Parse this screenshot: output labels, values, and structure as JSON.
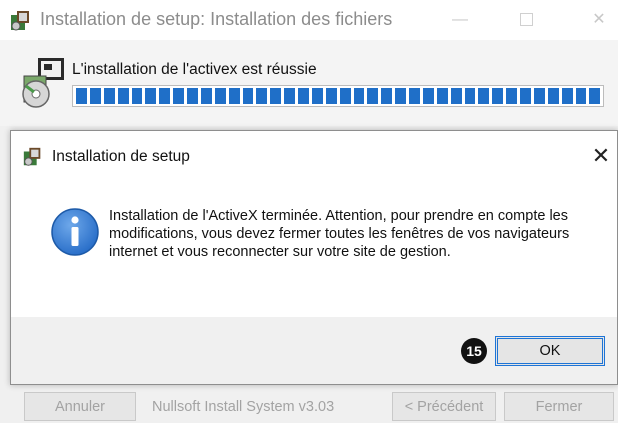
{
  "background_window": {
    "title": "Installation de setup: Installation des fichiers",
    "status_text": "L'installation de l'activex est réussie",
    "progress_percent": 100,
    "branding": "Nullsoft Install System v3.03",
    "buttons": {
      "cancel": "Annuler",
      "back": "< Précédent",
      "close": "Fermer"
    },
    "controls": {
      "minimize": "—",
      "close": "✕"
    }
  },
  "dialog": {
    "title": "Installation de setup",
    "close_glyph": "✕",
    "icon": "information-icon",
    "message": "Installation de l'ActiveX terminée. Attention, pour prendre en compte les modifications, vous devez fermer toutes les fenêtres de vos navigateurs internet et vous reconnecter sur votre site de gestion.",
    "ok_label": "OK"
  },
  "callout": {
    "number": "15"
  },
  "colors": {
    "progress_fill": "#1f6fc8",
    "focus_border": "#1e74d6",
    "info_icon": "#2a6fc9"
  }
}
